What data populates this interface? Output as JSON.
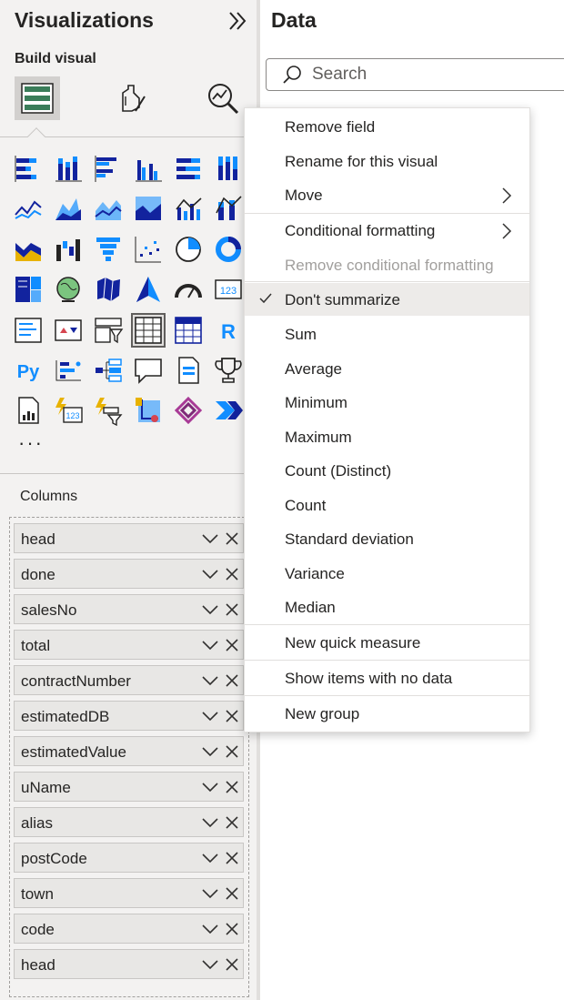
{
  "viz_pane": {
    "title": "Visualizations",
    "collapse_icon": "double-chevron-right-icon",
    "build_visual_label": "Build visual",
    "build_tabs": [
      {
        "icon": "build-visual-icon",
        "selected": true
      },
      {
        "icon": "format-visual-icon",
        "selected": false
      },
      {
        "icon": "analytics-icon",
        "selected": false
      }
    ],
    "visual_types": [
      "stacked-bar-icon",
      "stacked-column-icon",
      "clustered-bar-icon",
      "clustered-column-icon",
      "100-stacked-bar-icon",
      "100-stacked-column-icon",
      "line-chart-icon",
      "area-chart-icon",
      "stacked-area-icon",
      "100-stacked-area-icon",
      "line-clustered-column-icon",
      "line-stacked-column-icon",
      "ribbon-chart-icon",
      "waterfall-chart-icon",
      "funnel-chart-icon",
      "scatter-chart-icon",
      "pie-chart-icon",
      "donut-chart-icon",
      "treemap-icon",
      "map-icon",
      "filled-map-icon",
      "azure-map-icon",
      "gauge-icon",
      "card-icon",
      "multi-row-card-icon",
      "kpi-icon",
      "slicer-icon",
      "table-icon",
      "matrix-icon",
      "r-visual-icon",
      "python-visual-icon",
      "key-influencers-icon",
      "decomposition-tree-icon",
      "qna-icon",
      "paginated-report-icon",
      "trophy-icon",
      "report-icon",
      "power-apps-card-icon",
      "power-apps-slicer-icon",
      "power-automate-map-icon",
      "power-apps-icon",
      "power-automate-icon"
    ],
    "more_label": "···",
    "columns_label": "Columns",
    "fields": [
      "head",
      "done",
      "salesNo",
      "total",
      "contractNumber",
      "estimatedDB",
      "estimatedValue",
      "uName",
      "alias",
      "postCode",
      "town",
      "code",
      "head"
    ]
  },
  "data_pane": {
    "title": "Data",
    "search_placeholder": "Search",
    "search_value": ""
  },
  "context_menu": {
    "items": [
      {
        "label": "Remove field"
      },
      {
        "label": "Rename for this visual"
      },
      {
        "label": "Move",
        "submenu": true
      },
      {
        "label": "Conditional formatting",
        "submenu": true
      },
      {
        "label": "Remove conditional formatting",
        "disabled": true
      },
      {
        "label": "Don't summarize",
        "checked": true
      },
      {
        "label": "Sum"
      },
      {
        "label": "Average"
      },
      {
        "label": "Minimum"
      },
      {
        "label": "Maximum"
      },
      {
        "label": "Count (Distinct)"
      },
      {
        "label": "Count"
      },
      {
        "label": "Standard deviation"
      },
      {
        "label": "Variance"
      },
      {
        "label": "Median"
      },
      {
        "label": "New quick measure"
      },
      {
        "label": "Show items with no data"
      },
      {
        "label": "New group"
      }
    ]
  },
  "colors": {
    "accent": "#118dff",
    "accent_dark": "#12239e",
    "yellow": "#e8b200",
    "red": "#d64550",
    "pane_bg": "#f3f2f1",
    "selected_bg": "#d2d0ce",
    "menu_checked_bg": "#edebe9",
    "disabled_text": "#a19f9d"
  }
}
